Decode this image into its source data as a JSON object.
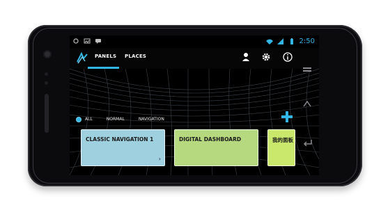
{
  "status": {
    "time": "2:50"
  },
  "tabs": [
    {
      "label": "PANELS"
    },
    {
      "label": "PLACES"
    }
  ],
  "filters": [
    {
      "label": "ALL"
    },
    {
      "label": "NORMAL"
    },
    {
      "label": "NAVIGATION"
    }
  ],
  "cards": [
    {
      "title": "CLASSIC NAVIGATION 1",
      "color": "#9fd0e0"
    },
    {
      "title": "DIGITAL DASHBOARD",
      "color": "#b6d87e"
    },
    {
      "title": "我的面板",
      "color": "#c9e86c"
    }
  ],
  "colors": {
    "accent": "#33b5e5"
  },
  "icons": [
    "app-logo-icon",
    "user-icon",
    "gear-icon",
    "info-icon",
    "add-icon",
    "chevron-right-icon",
    "back-icon",
    "home-icon",
    "recent-apps-icon"
  ]
}
